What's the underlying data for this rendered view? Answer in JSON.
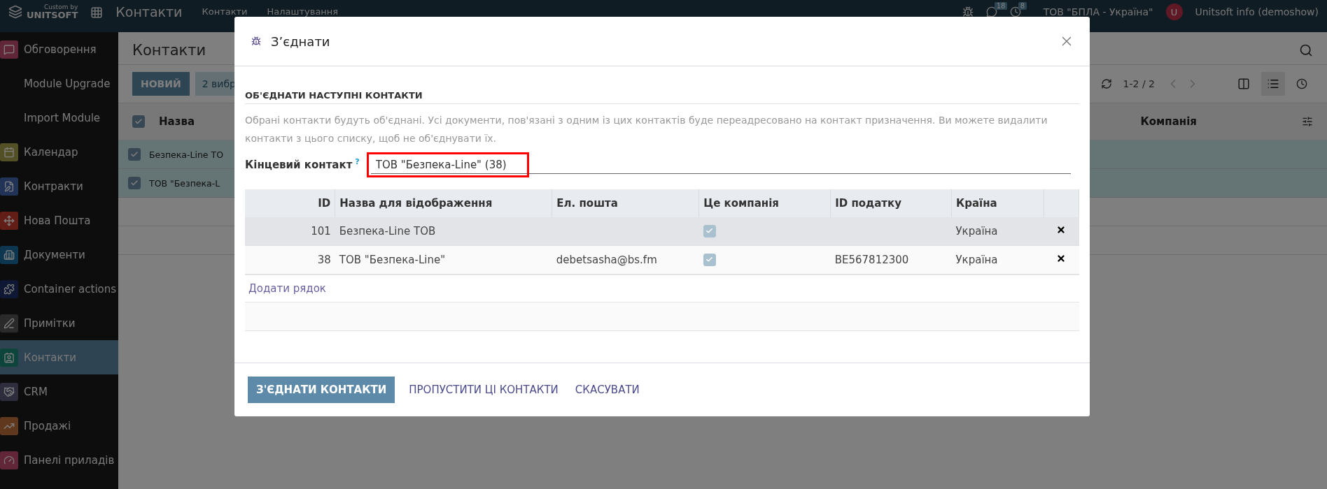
{
  "topbar": {
    "logo_top": "Custom by",
    "logo_bottom": "UNITSOFT",
    "app_title": "Контакти",
    "menu": [
      "Контакти",
      "Налаштування"
    ],
    "chat_count": "18",
    "activity_count": "8",
    "company": "ТОВ \"БПЛА - Україна\"",
    "avatar_letter": "U",
    "user": "Unitsoft info (demoshow)"
  },
  "sidebar": {
    "items": [
      {
        "label": "Обговорення",
        "selected": false
      },
      {
        "label": "Module Upgrade",
        "selected": false
      },
      {
        "label": "Import Module",
        "selected": false
      },
      {
        "label": "Календар",
        "selected": false
      },
      {
        "label": "Контракти",
        "selected": false
      },
      {
        "label": "Нова Пошта",
        "selected": false
      },
      {
        "label": "Документи",
        "selected": false
      },
      {
        "label": "Container actions",
        "selected": false
      },
      {
        "label": "Примітки",
        "selected": false
      },
      {
        "label": "Контакти",
        "selected": true
      },
      {
        "label": "CRM",
        "selected": false
      },
      {
        "label": "Продажі",
        "selected": false
      },
      {
        "label": "Панелі приладів",
        "selected": false
      }
    ]
  },
  "background": {
    "title": "Контакти",
    "new_button": "НОВИЙ",
    "selection_button": "2 вибр",
    "pager": "1-2 / 2",
    "columns": [
      "Назва",
      "Компанія"
    ],
    "rows": [
      {
        "name": "Безпека-Line ТО",
        "checked": true
      },
      {
        "name": "ТОВ \"Безпека-L",
        "checked": true
      }
    ],
    "all_checked": true
  },
  "dialog": {
    "title": "З’єднати",
    "section_title": "ОБ'ЄДНАТИ НАСТУПНІ КОНТАКТИ",
    "description": "Обрані контакти будуть об'єднані. Усі документи, пов'язані з одним із цих контактів буде переадресовано на контакт призначення. Ви можете видалити контакти з цього списку, щоб не об'єднувати їх.",
    "field_label": "Кінцевий контакт",
    "help_mark": "?",
    "field_value": "ТОВ \"Безпека-Line\" (38)",
    "table": {
      "columns": [
        "ID",
        "Назва для відображення",
        "Ел. пошта",
        "Це компанія",
        "ID податку",
        "Країна"
      ],
      "rows": [
        {
          "id": "101",
          "name": "Безпека-Line ТОВ",
          "email": "",
          "is_company": true,
          "tax_id": "",
          "country": "Україна",
          "selected": true
        },
        {
          "id": "38",
          "name": "ТОВ \"Безпека-Line\"",
          "email": "debetsasha@bs.fm",
          "is_company": true,
          "tax_id": "BE567812300",
          "country": "Україна",
          "selected": false
        }
      ]
    },
    "add_line": "Додати рядок",
    "buttons": [
      {
        "label": "З'ЄДНАТИ КОНТАКТИ",
        "kind": "primary"
      },
      {
        "label": "ПРОПУСТИТИ ЦІ КОНТАКТИ",
        "kind": "link"
      },
      {
        "label": "СКАСУВАТИ",
        "kind": "link"
      }
    ]
  }
}
